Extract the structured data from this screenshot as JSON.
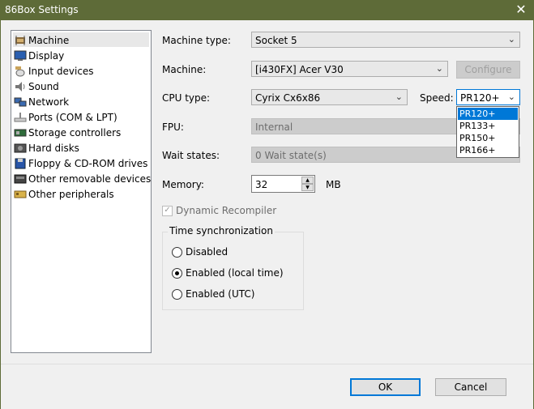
{
  "window": {
    "title": "86Box Settings",
    "close_glyph": "✕"
  },
  "sidebar": {
    "items": [
      {
        "label": "Machine",
        "icon": "machine-icon",
        "selected": true
      },
      {
        "label": "Display",
        "icon": "display-icon"
      },
      {
        "label": "Input devices",
        "icon": "input-devices-icon"
      },
      {
        "label": "Sound",
        "icon": "sound-icon"
      },
      {
        "label": "Network",
        "icon": "network-icon"
      },
      {
        "label": "Ports (COM & LPT)",
        "icon": "ports-icon"
      },
      {
        "label": "Storage controllers",
        "icon": "storage-controllers-icon"
      },
      {
        "label": "Hard disks",
        "icon": "hard-disk-icon"
      },
      {
        "label": "Floppy & CD-ROM drives",
        "icon": "floppy-icon"
      },
      {
        "label": "Other removable devices",
        "icon": "removable-devices-icon"
      },
      {
        "label": "Other peripherals",
        "icon": "peripherals-icon"
      }
    ]
  },
  "form": {
    "machine_type_label": "Machine type:",
    "machine_type_value": "Socket 5",
    "machine_label": "Machine:",
    "machine_value": "[i430FX] Acer V30",
    "configure_label": "Configure",
    "cpu_type_label": "CPU type:",
    "cpu_type_value": "Cyrix Cx6x86",
    "speed_label": "Speed:",
    "speed_value": "PR120+",
    "speed_options": [
      "PR120+",
      "PR133+",
      "PR150+",
      "PR166+"
    ],
    "fpu_label": "FPU:",
    "fpu_value": "Internal",
    "wait_states_label": "Wait states:",
    "wait_states_value": "0 Wait state(s)",
    "memory_label": "Memory:",
    "memory_value": "32",
    "memory_unit": "MB",
    "dynamic_recompiler_label": "Dynamic Recompiler",
    "time_sync_title": "Time synchronization",
    "time_sync_options": [
      {
        "label": "Disabled",
        "selected": false
      },
      {
        "label": "Enabled (local time)",
        "selected": true
      },
      {
        "label": "Enabled (UTC)",
        "selected": false
      }
    ]
  },
  "footer": {
    "ok_label": "OK",
    "cancel_label": "Cancel"
  },
  "colors": {
    "titlebar": "#5e6b38",
    "selection": "#0078d7"
  }
}
